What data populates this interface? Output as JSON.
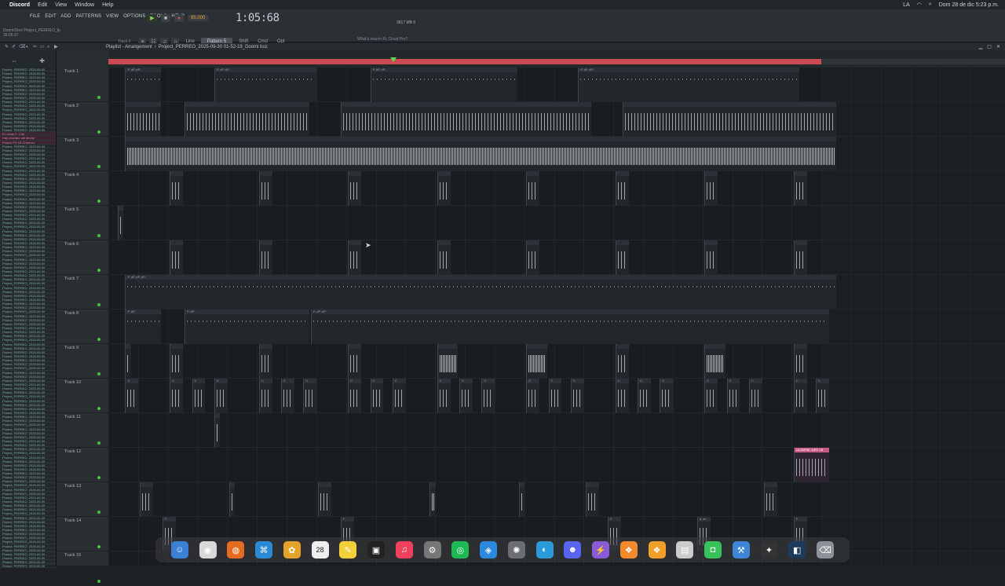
{
  "menubar": {
    "app": "Discord",
    "items": [
      "Edit",
      "View",
      "Window",
      "Help"
    ],
    "clock": "Dom 28 de dic 5:23 p.m.",
    "input_label": "LA"
  },
  "toolbar": {
    "fl_menu": [
      "FILE",
      "EDIT",
      "ADD",
      "PATTERNS",
      "VIEW",
      "OPTIONS",
      "TOOLS",
      "HELP"
    ],
    "project_hint": "DoomiDoo! Project_PERREO_fp",
    "hint_time": "35:05:37",
    "track_hint": "Track 6",
    "tempo": "95.000",
    "time": "1:05:68",
    "pattern": "Pattern 5",
    "snap": "Line",
    "buttons": [
      "Shift",
      "Cmd",
      "Opt"
    ],
    "news": "What's new in FL Cloud Pro?",
    "cpu_value": "3817 MB",
    "cpu_num": "6"
  },
  "playlist": {
    "title": "Playlist - Arrangement",
    "breadcrumb": "Project_PERREO_2025-09-30 01-52-19_Doomi boz"
  },
  "browser": {
    "items": [
      "Project_PERREO_2025-09-30",
      "Project_PERREO_2025-09-30",
      "Project_PERREO_2025-09-30",
      "Project_PERREO_2025-09-30",
      "Project_PERREO_2025-09-30",
      "Project_PERREO_2025-09-30",
      "Project_PERREO_2025-09-30",
      "Project_PERREO_2025-09-30",
      "Project_PERREO_2025-09-30",
      "Project_PERREO_2025-09-30",
      "Project_PERREO_2025-09-30",
      "Project_PERREO_2025-09-30",
      "Project_PERREO_2025-09-30",
      "Project_PERREO_2025-09-30",
      "Project_PERREO_2025-09-30",
      "Project_PERREO_2025-09-30",
      "Fx clean 9_Cha",
      "Hay chombo old decay",
      "Project FX 15 (Chorus)",
      "Project_PERREO_2025-09-30",
      "Project_PERREO_2025-09-30",
      "Project_PERREO_2025-09-30",
      "Project_PERREO_2025-09-30",
      "Project_PERREO_2025-09-30",
      "Project_PERREO_2025-09-30",
      "Project_PERREO_2025-09-30",
      "Project_PERREO_2025-09-30",
      "Project_PERREO_2025-09-30",
      "Project_PERREO_2025-09-30",
      "Project_PERREO_2025-09-30",
      "Project_PERREO_2025-09-30",
      "Project_PERREO_2025-09-30",
      "Project_PERREO_2025-09-30",
      "Project_PERREO_2025-09-30",
      "Project_PERREO_2025-09-30",
      "Project_PERREO_2025-09-30",
      "Project_PERREO_2025-09-30",
      "Project_PERREO_2025-09-30",
      "Project_PERREO_2025-09-30",
      "Project_PERREO_2025-09-30",
      "Project_PERREO_2025-09-30",
      "Project_PERREO_2025-09-30",
      "Project_PERREO_2025-09-30",
      "Project_PERREO_2025-09-30",
      "Project_PERREO_2025-09-30",
      "Project_PERREO_2025-09-30",
      "Project_PERREO_2025-09-30",
      "Project_PERREO_2025-09-30",
      "Project_PERREO_2025-09-30",
      "Project_PERREO_2025-09-30",
      "Project_PERREO_2025-09-30",
      "Project_PERREO_2025-09-30",
      "Project_PERREO_2025-09-30",
      "Project_PERREO_2025-09-30",
      "Project_PERREO_2025-09-30",
      "Project_PERREO_2025-09-30",
      "Project_PERREO_2025-09-30",
      "Project_PERREO_2025-09-30",
      "Project_PERREO_2025-09-30",
      "Project_PERREO_2025-09-30",
      "Project_PERREO_2025-09-30",
      "Project_PERREO_2025-09-30",
      "Project_PERREO_2025-09-30",
      "Project_PERREO_2025-09-30",
      "Project_PERREO_2025-09-30",
      "Project_PERREO_2025-09-30",
      "Project_PERREO_2025-09-30",
      "Project_PERREO_2025-09-30",
      "Project_PERREO_2025-09-30",
      "Project_PERREO_2025-09-30",
      "Project_PERREO_2025-09-30",
      "Project_PERREO_2025-09-30",
      "Project_PERREO_2025-09-30",
      "Project_PERREO_2025-09-30",
      "Project_PERREO_2025-09-30",
      "Project_PERREO_2025-09-30",
      "Project_PERREO_2025-09-30",
      "Project_PERREO_2025-09-30",
      "Project_PERREO_2025-09-30",
      "Project_PERREO_2025-09-30",
      "Project_PERREO_2025-09-30",
      "Project_PERREO_2025-09-30",
      "Project_PERREO_2025-09-30",
      "Project_PERREO_2025-09-30",
      "Project_PERREO_2025-09-30",
      "Project_PERREO_2025-09-30",
      "Project_PERREO_2025-09-30",
      "Project_PERREO_2025-09-30",
      "Project_PERREO_2025-09-30",
      "Project_PERREO_2025-09-30",
      "Project_PERREO_2025-09-30",
      "Project_PERREO_2025-09-30",
      "Project_PERREO_2025-09-30",
      "Project_PERREO_2025-09-30",
      "Project_PERREO_2025-09-30",
      "Project_PERREO_2025-09-30",
      "Project_PERREO_2025-09-30",
      "Project_PERREO_2025-09-30",
      "Project_PERREO_2025-09-30",
      "Project_PERREO_2025-09-30",
      "Project_PERREO_2025-09-30",
      "Project_PERREO_2025-09-30",
      "Project_PERREO_2025-09-30",
      "Project_PERREO_2025-09-30",
      "Project_PERREO_2025-09-30",
      "Project_PERREO_2025-09-30",
      "Project_PERREO_2025-09-30",
      "Project_PERREO_2025-09-30",
      "Project_PERREO_2025-09-30",
      "Project_PERREO_2025-09-30",
      "Project_PERREO_2025-09-30",
      "Project_PERREO_2025-09-30",
      "Project_PERREO_2025-09-30",
      "Project_PERREO_2025-09-30",
      "Project_PERREO_2025-09-30",
      "Project_PERREO_2025-09-30",
      "Project_PERREO_2025-09-30",
      "Project_PERREO_2025-09-30",
      "Project_PERREO_2025-09-30",
      "Project_PERREO_2025-09-30",
      "Project_PERREO_2025-09-30",
      "Project_PERREO_2025-09-30",
      "Project_PERREO_2025-09-30",
      "Project_PERREO_2025-09-30"
    ],
    "highlighted": [
      16,
      17,
      18
    ]
  },
  "tracks": [
    {
      "name": "Track 1",
      "clips": [
        {
          "bar": 1,
          "len": 5,
          "label": "P..#P..#P..",
          "style": "dots"
        },
        {
          "bar": 13,
          "len": 14,
          "label": "P..#P..#P..",
          "style": "dots"
        },
        {
          "bar": 34,
          "len": 20,
          "label": "P..#P..#P..",
          "style": "dots"
        },
        {
          "bar": 62,
          "len": 30,
          "label": "P..#P..#P..",
          "style": "dots"
        }
      ]
    },
    {
      "name": "Track 2",
      "clips": [
        {
          "bar": 1,
          "len": 5,
          "label": "",
          "style": ""
        },
        {
          "bar": 9,
          "len": 17,
          "label": "",
          "style": ""
        },
        {
          "bar": 30,
          "len": 34,
          "label": "",
          "style": ""
        },
        {
          "bar": 68,
          "len": 29,
          "label": "",
          "style": ""
        }
      ]
    },
    {
      "name": "Track 3",
      "clips": [
        {
          "bar": 1,
          "len": 96,
          "label": "",
          "style": "dense"
        }
      ]
    },
    {
      "name": "Track 4",
      "clips": [
        {
          "bar": 7,
          "len": 2,
          "label": "",
          "style": ""
        },
        {
          "bar": 19,
          "len": 2,
          "label": "",
          "style": ""
        },
        {
          "bar": 31,
          "len": 2,
          "label": "",
          "style": ""
        },
        {
          "bar": 43,
          "len": 2,
          "label": "",
          "style": ""
        },
        {
          "bar": 55,
          "len": 2,
          "label": "",
          "style": ""
        },
        {
          "bar": 67,
          "len": 2,
          "label": "",
          "style": ""
        },
        {
          "bar": 79,
          "len": 2,
          "label": "",
          "style": ""
        },
        {
          "bar": 91,
          "len": 2,
          "label": "",
          "style": ""
        }
      ]
    },
    {
      "name": "Track 5",
      "clips": [
        {
          "bar": 0,
          "len": 1,
          "label": "",
          "style": ""
        }
      ]
    },
    {
      "name": "Track 6",
      "clips": [
        {
          "bar": 7,
          "len": 2,
          "label": "",
          "style": ""
        },
        {
          "bar": 19,
          "len": 2,
          "label": "",
          "style": ""
        },
        {
          "bar": 31,
          "len": 2,
          "label": "",
          "style": ""
        },
        {
          "bar": 43,
          "len": 2,
          "label": "",
          "style": ""
        },
        {
          "bar": 55,
          "len": 2,
          "label": "",
          "style": ""
        },
        {
          "bar": 67,
          "len": 2,
          "label": "",
          "style": ""
        },
        {
          "bar": 79,
          "len": 2,
          "label": "",
          "style": ""
        },
        {
          "bar": 91,
          "len": 2,
          "label": "",
          "style": ""
        }
      ]
    },
    {
      "name": "Track 7",
      "clips": [
        {
          "bar": 1,
          "len": 96,
          "label": "P..#P..#P..#P..",
          "style": "dots"
        }
      ]
    },
    {
      "name": "Track 8",
      "clips": [
        {
          "bar": 1,
          "len": 5,
          "label": "P..#P..",
          "style": "dots"
        },
        {
          "bar": 9,
          "len": 17,
          "label": "P..#P..",
          "style": "dots"
        },
        {
          "bar": 26,
          "len": 70,
          "label": "P..#P..#P..",
          "style": "dots"
        }
      ]
    },
    {
      "name": "Track 9",
      "clips": [
        {
          "bar": 1,
          "len": 1,
          "label": "",
          "style": ""
        },
        {
          "bar": 7,
          "len": 2,
          "label": "",
          "style": ""
        },
        {
          "bar": 19,
          "len": 2,
          "label": "",
          "style": ""
        },
        {
          "bar": 31,
          "len": 2,
          "label": "",
          "style": ""
        },
        {
          "bar": 43,
          "len": 3,
          "label": "",
          "style": "dense"
        },
        {
          "bar": 55,
          "len": 3,
          "label": "",
          "style": "dense"
        },
        {
          "bar": 67,
          "len": 2,
          "label": "",
          "style": ""
        },
        {
          "bar": 79,
          "len": 3,
          "label": "",
          "style": "dense"
        },
        {
          "bar": 91,
          "len": 2,
          "label": "",
          "style": ""
        }
      ]
    },
    {
      "name": "Track 10",
      "clips": [
        {
          "bar": 1,
          "len": 2,
          "label": "C",
          "style": ""
        },
        {
          "bar": 7,
          "len": 2,
          "label": "C",
          "style": ""
        },
        {
          "bar": 10,
          "len": 2,
          "label": "C",
          "style": ""
        },
        {
          "bar": 13,
          "len": 2,
          "label": "C",
          "style": ""
        },
        {
          "bar": 19,
          "len": 2,
          "label": "C",
          "style": ""
        },
        {
          "bar": 22,
          "len": 2,
          "label": "C",
          "style": ""
        },
        {
          "bar": 25,
          "len": 2,
          "label": "C",
          "style": ""
        },
        {
          "bar": 31,
          "len": 2,
          "label": "C",
          "style": ""
        },
        {
          "bar": 34,
          "len": 2,
          "label": "C",
          "style": ""
        },
        {
          "bar": 37,
          "len": 2,
          "label": "C",
          "style": ""
        },
        {
          "bar": 43,
          "len": 2,
          "label": "C",
          "style": ""
        },
        {
          "bar": 46,
          "len": 2,
          "label": "C",
          "style": ""
        },
        {
          "bar": 49,
          "len": 2,
          "label": "C",
          "style": ""
        },
        {
          "bar": 55,
          "len": 2,
          "label": "C",
          "style": ""
        },
        {
          "bar": 58,
          "len": 2,
          "label": "C",
          "style": ""
        },
        {
          "bar": 61,
          "len": 2,
          "label": "C",
          "style": ""
        },
        {
          "bar": 67,
          "len": 2,
          "label": "C",
          "style": ""
        },
        {
          "bar": 70,
          "len": 2,
          "label": "C",
          "style": ""
        },
        {
          "bar": 73,
          "len": 2,
          "label": "C",
          "style": ""
        },
        {
          "bar": 79,
          "len": 2,
          "label": "C",
          "style": ""
        },
        {
          "bar": 82,
          "len": 2,
          "label": "C",
          "style": ""
        },
        {
          "bar": 85,
          "len": 2,
          "label": "C",
          "style": ""
        },
        {
          "bar": 91,
          "len": 2,
          "label": "C",
          "style": ""
        },
        {
          "bar": 94,
          "len": 2,
          "label": "C",
          "style": ""
        }
      ]
    },
    {
      "name": "Track 11",
      "clips": [
        {
          "bar": 13,
          "len": 1,
          "label": "",
          "style": "dense"
        }
      ]
    },
    {
      "name": "Track 12",
      "clips": [
        {
          "bar": 91,
          "len": 5,
          "label": "LA DIRSE..DRY 1B",
          "style": "pink"
        }
      ]
    },
    {
      "name": "Track 13",
      "clips": [
        {
          "bar": 3,
          "len": 2,
          "label": "",
          "style": ""
        },
        {
          "bar": 15,
          "len": 1,
          "label": "",
          "style": ""
        },
        {
          "bar": 27,
          "len": 2,
          "label": "",
          "style": ""
        },
        {
          "bar": 42,
          "len": 1,
          "label": "",
          "style": "dense"
        },
        {
          "bar": 54,
          "len": 1,
          "label": "",
          "style": ""
        },
        {
          "bar": 63,
          "len": 2,
          "label": "",
          "style": ""
        },
        {
          "bar": 87,
          "len": 2,
          "label": "",
          "style": ""
        }
      ]
    },
    {
      "name": "Track 14",
      "clips": [
        {
          "bar": 6,
          "len": 2,
          "label": "F..",
          "style": ""
        },
        {
          "bar": 30,
          "len": 2,
          "label": "F..",
          "style": ""
        },
        {
          "bar": 66,
          "len": 2,
          "label": "F..",
          "style": ""
        },
        {
          "bar": 78,
          "len": 2,
          "label": "d..an",
          "style": ""
        },
        {
          "bar": 91,
          "len": 2,
          "label": "F..",
          "style": ""
        }
      ]
    },
    {
      "name": "Track 15",
      "clips": []
    }
  ],
  "timeline": {
    "bars_visible": 98,
    "active_bars": 96,
    "playhead_bar": 38
  },
  "dock": {
    "apps": [
      "finder-icon",
      "chrome-icon",
      "firefox-icon",
      "vscode-icon",
      "photos-icon",
      "calendar-icon",
      "notes-icon",
      "tv-icon",
      "music-icon",
      "settings-icon",
      "spotify-icon",
      "safari-icon",
      "fl-studio-icon",
      "audio-icon",
      "discord-icon",
      "instruments-icon",
      "fl-icon",
      "fl2-icon",
      "doc-icon",
      "facetime-icon",
      "xcode-icon",
      "tool-icon",
      "photoshop-icon",
      "trash-icon"
    ],
    "calendar_day": "28"
  }
}
